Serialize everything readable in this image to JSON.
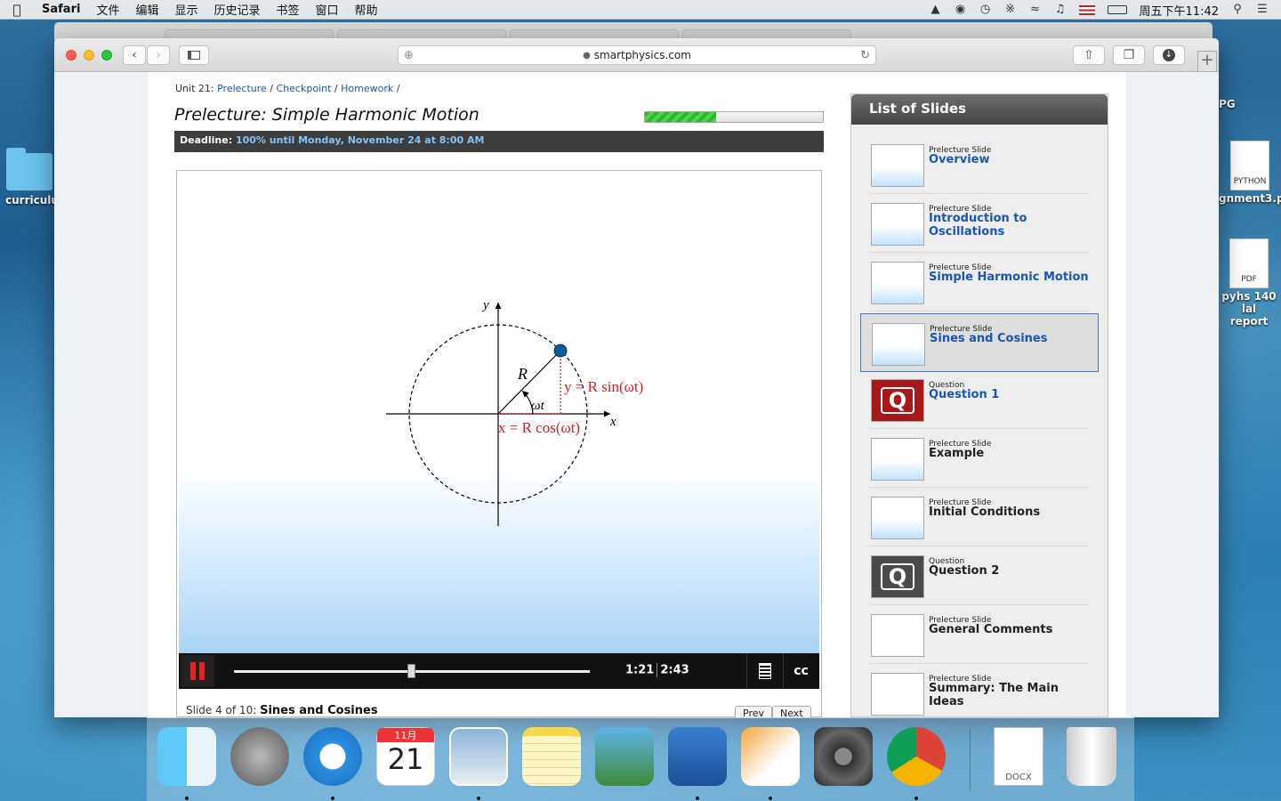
{
  "menubar": {
    "apple": "",
    "app": "Safari",
    "items": [
      "文件",
      "编辑",
      "显示",
      "历史记录",
      "书签",
      "窗口",
      "帮助"
    ],
    "clock": "周五下午11:42"
  },
  "desktop": {
    "left_folder": "curriculu",
    "python_file": "gnment3.py",
    "python_badge": "PYTHON",
    "pdf_file_line1": "pyhs 140 lal",
    "pdf_file_line2": "report",
    "pdf_badge": "PDF",
    "top_right_label": "PG"
  },
  "browser": {
    "url": "smartphysics.com"
  },
  "page": {
    "breadcrumb": {
      "unit": "Unit 21:",
      "links": [
        "Prelecture",
        "Checkpoint",
        "Homework"
      ],
      "sep": "/"
    },
    "title": "Prelecture: Simple Harmonic Motion",
    "progress": 0.4,
    "deadline_label": "Deadline:",
    "deadline_value": "100% until Monday, November 24 at 8:00 AM"
  },
  "slide_figure": {
    "y_axis": "y",
    "x_axis": "x",
    "radius": "R",
    "angle": "ωt",
    "y_eq": "y = R sin(ωt)",
    "x_eq": "x = R cos(ωt)"
  },
  "player": {
    "current_time": "1:21",
    "total_time": "2:43",
    "position": 0.5,
    "cc_label": "cc",
    "slide_info_prefix": "Slide 4 of 10:",
    "slide_info_title": "Sines and Cosines",
    "prev": "Prev",
    "next": "Next"
  },
  "slides_panel": {
    "title": "List of Slides",
    "items": [
      {
        "type": "Prelecture Slide",
        "name": "Overview"
      },
      {
        "type": "Prelecture Slide",
        "name": "Introduction to Oscillations"
      },
      {
        "type": "Prelecture Slide",
        "name": "Simple Harmonic Motion"
      },
      {
        "type": "Prelecture Slide",
        "name": "Sines and Cosines"
      },
      {
        "type": "Question",
        "name": "Question 1"
      },
      {
        "type": "Prelecture Slide",
        "name": "Example"
      },
      {
        "type": "Prelecture Slide",
        "name": "Initial Conditions"
      },
      {
        "type": "Question",
        "name": "Question 2"
      },
      {
        "type": "Prelecture Slide",
        "name": "General Comments"
      },
      {
        "type": "Prelecture Slide",
        "name": "Summary: The Main Ideas"
      }
    ],
    "q_glyph": "Q"
  },
  "dock": {
    "calendar_month": "11月",
    "calendar_day": "21",
    "docx_label": "DOCX",
    "icons": [
      "finder-icon",
      "launchpad-icon",
      "safari-icon",
      "calendar-icon",
      "mail-icon",
      "notes-icon",
      "iphoto-icon",
      "dictionary-icon",
      "pages-icon",
      "system-preferences-icon",
      "chrome-icon",
      "docx-file-icon",
      "trash-icon"
    ]
  },
  "colors": {
    "link": "#1a56b3",
    "deadline_bg": "#3d3d3d",
    "equation_red": "#cc2222",
    "progress_green": "#2db52d"
  }
}
